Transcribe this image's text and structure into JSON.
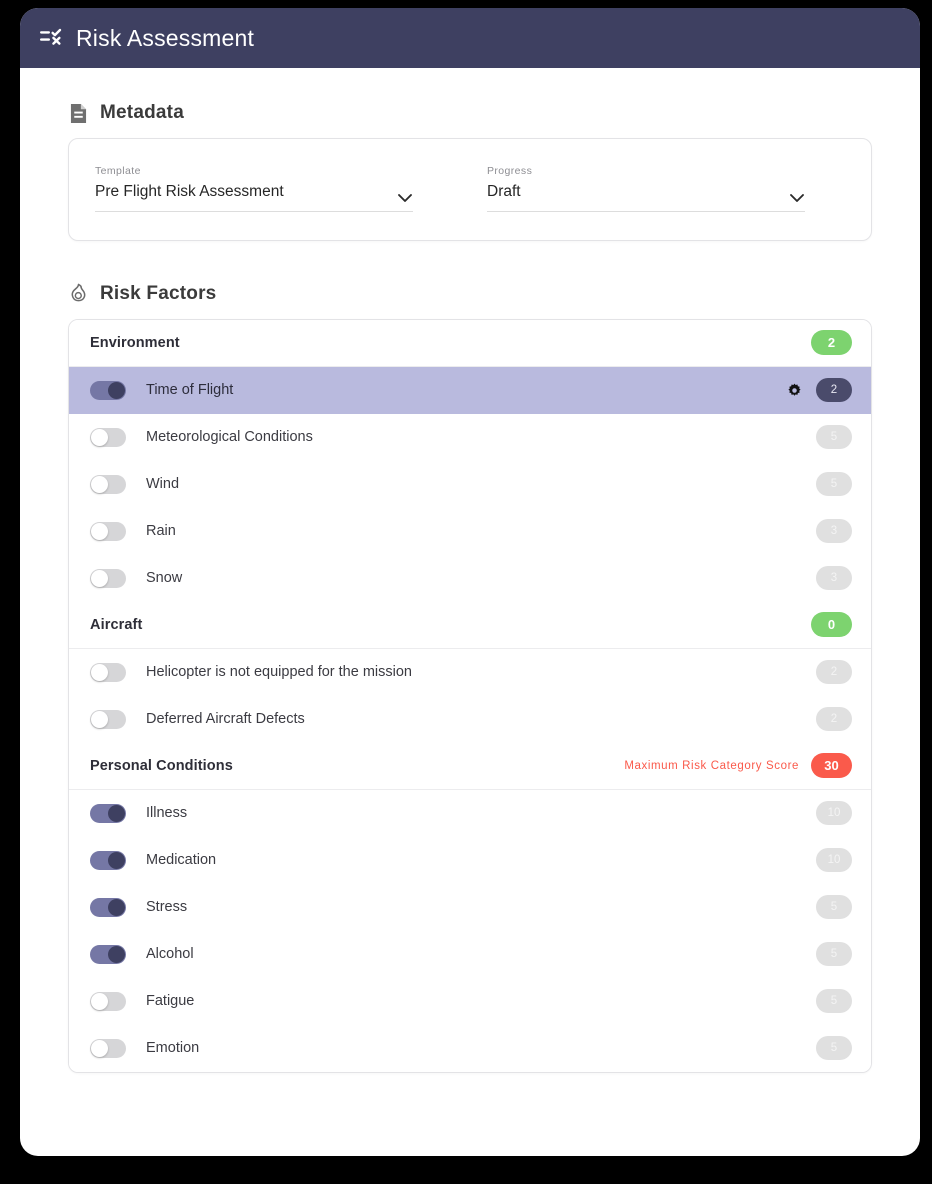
{
  "header": {
    "title": "Risk Assessment",
    "icon": "checklist-icon",
    "background": "#3e4061"
  },
  "metadata": {
    "section_title": "Metadata",
    "section_icon": "document-icon",
    "fields": [
      {
        "label": "Template",
        "value": "Pre Flight Risk Assessment",
        "icon": "chevron-down-icon"
      },
      {
        "label": "Progress",
        "value": "Draft",
        "icon": "chevron-down-icon"
      }
    ]
  },
  "risk_factors": {
    "section_title": "Risk Factors",
    "section_icon": "flame-icon",
    "colors": {
      "green": "#7dd36f",
      "red": "#fa5a4b",
      "toggle_on": "#7577a5",
      "highlight_row": "#b9bade"
    },
    "categories": [
      {
        "name": "Environment",
        "score": "2",
        "score_color": "green",
        "note": "",
        "items": [
          {
            "label": "Time of Flight",
            "on": true,
            "value": "2",
            "highlighted": true,
            "gear": true
          },
          {
            "label": "Meteorological Conditions",
            "on": false,
            "value": "5",
            "highlighted": false,
            "gear": false
          },
          {
            "label": "Wind",
            "on": false,
            "value": "5",
            "highlighted": false,
            "gear": false
          },
          {
            "label": "Rain",
            "on": false,
            "value": "3",
            "highlighted": false,
            "gear": false
          },
          {
            "label": "Snow",
            "on": false,
            "value": "3",
            "highlighted": false,
            "gear": false
          }
        ]
      },
      {
        "name": "Aircraft",
        "score": "0",
        "score_color": "green",
        "note": "",
        "items": [
          {
            "label": "Helicopter is not equipped for the mission",
            "on": false,
            "value": "2",
            "highlighted": false,
            "gear": false
          },
          {
            "label": "Deferred Aircraft Defects",
            "on": false,
            "value": "2",
            "highlighted": false,
            "gear": false
          }
        ]
      },
      {
        "name": "Personal Conditions",
        "score": "30",
        "score_color": "red",
        "note": "Maximum Risk Category Score",
        "items": [
          {
            "label": "Illness",
            "on": true,
            "value": "10",
            "highlighted": false,
            "gear": false
          },
          {
            "label": "Medication",
            "on": true,
            "value": "10",
            "highlighted": false,
            "gear": false
          },
          {
            "label": "Stress",
            "on": true,
            "value": "5",
            "highlighted": false,
            "gear": false
          },
          {
            "label": "Alcohol",
            "on": true,
            "value": "5",
            "highlighted": false,
            "gear": false
          },
          {
            "label": "Fatigue",
            "on": false,
            "value": "5",
            "highlighted": false,
            "gear": false
          },
          {
            "label": "Emotion",
            "on": false,
            "value": "5",
            "highlighted": false,
            "gear": false
          }
        ]
      }
    ]
  }
}
